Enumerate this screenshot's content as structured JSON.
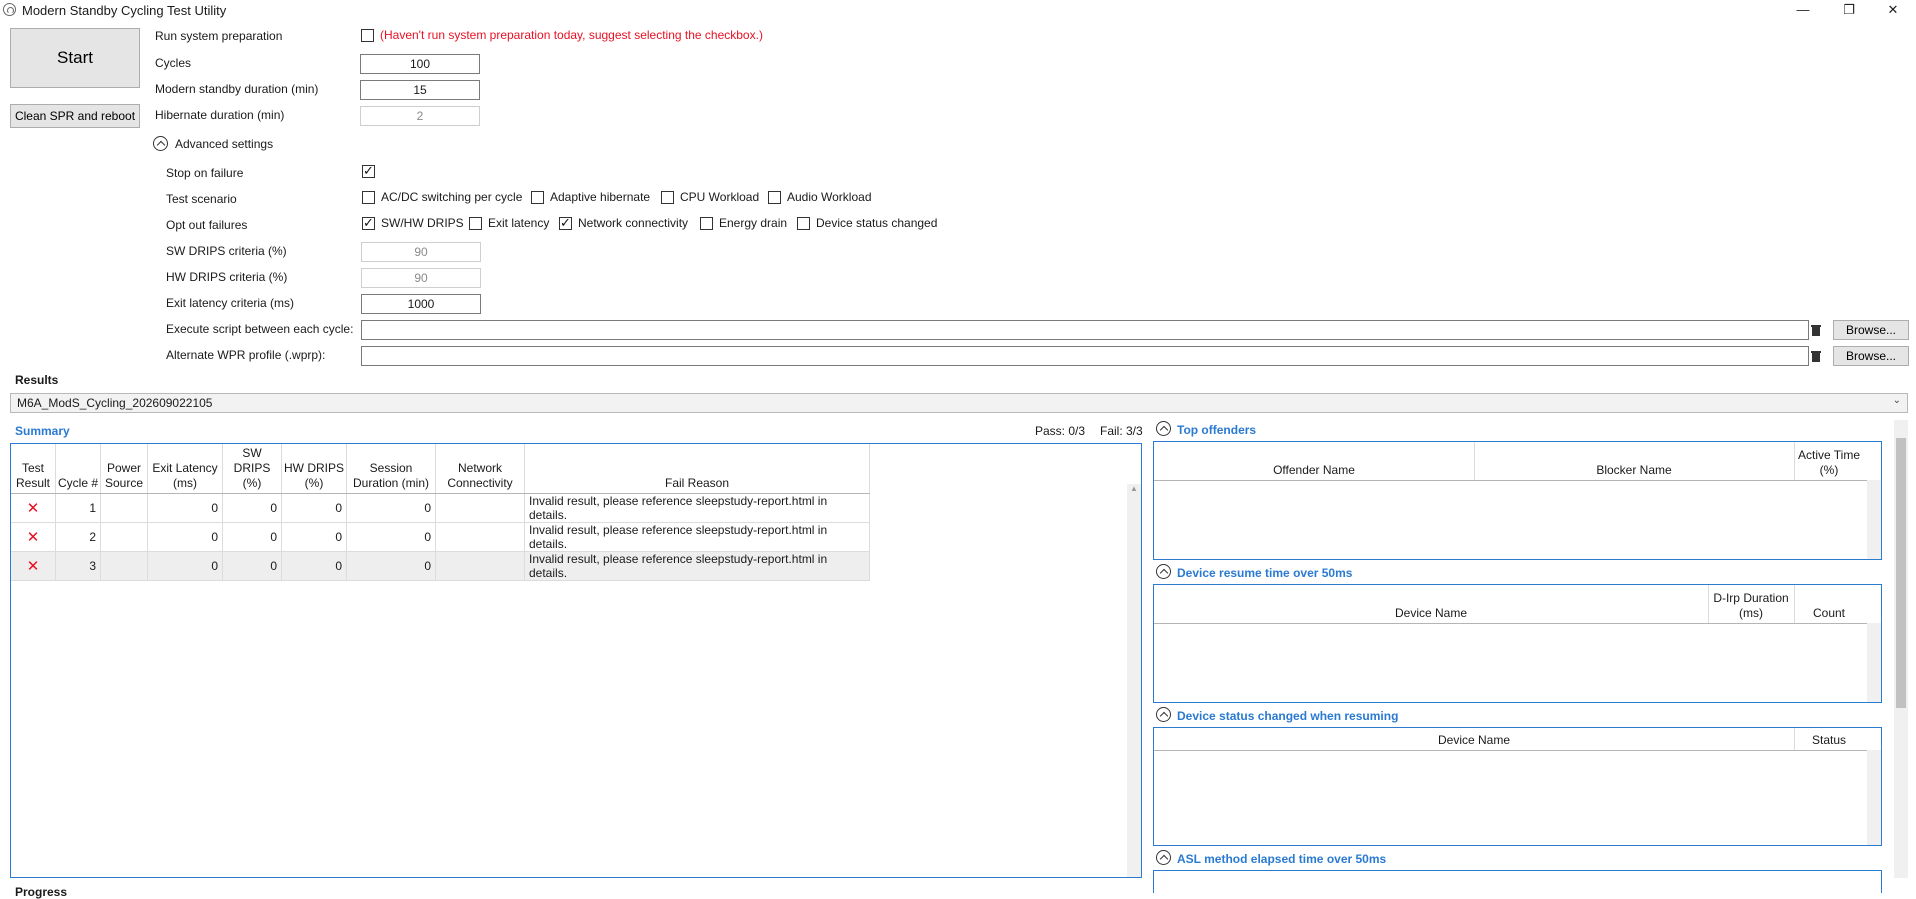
{
  "window": {
    "title": "Modern Standby Cycling Test Utility",
    "minimize": "—",
    "maximize": "❐",
    "close": "✕"
  },
  "actions": {
    "start": "Start",
    "clean": "Clean SPR and reboot"
  },
  "settings": {
    "run_prep_label": "Run system preparation",
    "run_prep_checked": false,
    "run_prep_warning": "(Haven't run system preparation today, suggest selecting the checkbox.)",
    "cycles_label": "Cycles",
    "cycles_value": "100",
    "ms_duration_label": "Modern standby duration (min)",
    "ms_duration_value": "15",
    "hib_duration_label": "Hibernate duration (min)",
    "hib_duration_value": "2"
  },
  "advanced": {
    "toggle_label": "Advanced settings",
    "stop_on_failure_label": "Stop on failure",
    "stop_on_failure_checked": true,
    "test_scenario_label": "Test scenario",
    "scenarios": [
      {
        "label": "AC/DC switching per cycle",
        "checked": false
      },
      {
        "label": "Adaptive hibernate",
        "checked": false
      },
      {
        "label": "CPU Workload",
        "checked": false
      },
      {
        "label": "Audio Workload",
        "checked": false
      }
    ],
    "opt_out_label": "Opt out failures",
    "opt_outs": [
      {
        "label": "SW/HW DRIPS",
        "checked": true
      },
      {
        "label": "Exit latency",
        "checked": false
      },
      {
        "label": "Network connectivity",
        "checked": true
      },
      {
        "label": "Energy drain",
        "checked": false
      },
      {
        "label": "Device status changed",
        "checked": false
      }
    ],
    "sw_drips_label": "SW DRIPS criteria (%)",
    "sw_drips_value": "90",
    "hw_drips_label": "HW DRIPS criteria (%)",
    "hw_drips_value": "90",
    "exit_latency_label": "Exit latency criteria (ms)",
    "exit_latency_value": "1000",
    "script_label": "Execute script between each cycle:",
    "script_value": "",
    "wprp_label": "Alternate WPR profile (.wprp):",
    "wprp_value": "",
    "browse": "Browse..."
  },
  "results": {
    "label": "Results",
    "selected_run": "M6A_ModS_Cycling_202609022105",
    "summary_label": "Summary",
    "pass": "Pass: 0/3",
    "fail": "Fail: 3/3",
    "columns": [
      "Test Result",
      "Cycle #",
      "Power Source",
      "Exit Latency (ms)",
      "SW DRIPS (%)",
      "HW DRIPS (%)",
      "Session Duration (min)",
      "Network Connectivity",
      "Fail Reason"
    ],
    "rows": [
      {
        "result": "✕",
        "cycle": "1",
        "power": "",
        "exit_latency": "0",
        "sw": "0",
        "hw": "0",
        "session": "0",
        "network": "",
        "reason": "Invalid result, please reference sleepstudy-report.html in details."
      },
      {
        "result": "✕",
        "cycle": "2",
        "power": "",
        "exit_latency": "0",
        "sw": "0",
        "hw": "0",
        "session": "0",
        "network": "",
        "reason": "Invalid result, please reference sleepstudy-report.html in details."
      },
      {
        "result": "✕",
        "cycle": "3",
        "power": "",
        "exit_latency": "0",
        "sw": "0",
        "hw": "0",
        "session": "0",
        "network": "",
        "reason": "Invalid result, please reference sleepstudy-report.html in details."
      }
    ]
  },
  "side": {
    "top_offenders": {
      "title": "Top offenders",
      "cols": [
        "Offender Name",
        "Blocker Name",
        "Active Time (%)"
      ]
    },
    "resume": {
      "title": "Device resume time over 50ms",
      "cols": [
        "Device Name",
        "D-Irp Duration (ms)",
        "Count"
      ]
    },
    "status": {
      "title": "Device status changed when resuming",
      "cols": [
        "Device Name",
        "Status"
      ]
    },
    "asl": {
      "title": "ASL method elapsed time over 50ms"
    }
  },
  "progress_label": "Progress",
  "colors": {
    "accent": "#2a7ad2",
    "error": "#e81123"
  }
}
